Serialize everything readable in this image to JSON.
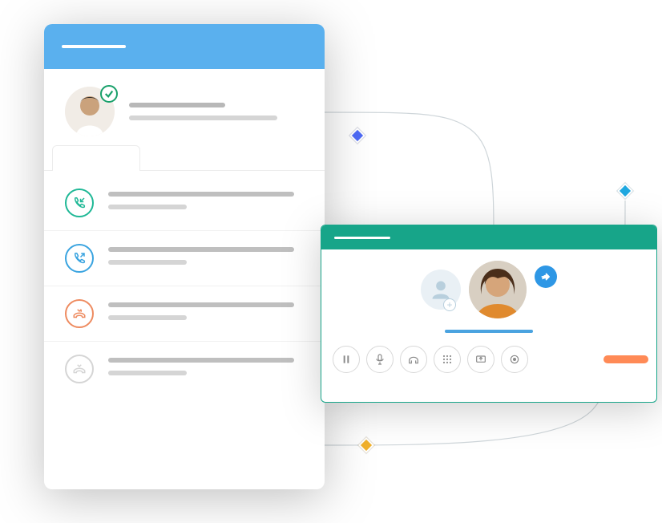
{
  "colors": {
    "list_header": "#5ab0ee",
    "call_header": "#17a589",
    "accent": "#4aa3e0",
    "hangup": "#ff8a56"
  },
  "nodes": [
    {
      "name": "node-purple",
      "color": "blue"
    },
    {
      "name": "node-cyan",
      "color": "cyan"
    },
    {
      "name": "node-yellow",
      "color": "yellow"
    }
  ],
  "contact_list": {
    "header_stub": "",
    "profile": {
      "status_icon": "check-icon"
    },
    "tabs": [
      {
        "active": true
      },
      {
        "active": false
      },
      {
        "active": false
      }
    ],
    "rows": [
      {
        "icon": "incoming-call-icon",
        "variant": "in"
      },
      {
        "icon": "outgoing-call-icon",
        "variant": "out"
      },
      {
        "icon": "missed-call-icon",
        "variant": "miss"
      },
      {
        "icon": "missed-call-icon",
        "variant": "none"
      }
    ]
  },
  "call_panel": {
    "header_stub": "",
    "add_button_plus": "+",
    "forward_icon": "arrow-forward-icon",
    "controls": [
      {
        "name": "pause-button",
        "icon": "pause-icon"
      },
      {
        "name": "mute-button",
        "icon": "mic-icon"
      },
      {
        "name": "audio-button",
        "icon": "headphones-icon"
      },
      {
        "name": "dialpad-button",
        "icon": "dialpad-icon"
      },
      {
        "name": "screen-button",
        "icon": "screen-share-icon"
      },
      {
        "name": "record-button",
        "icon": "record-icon"
      }
    ]
  }
}
